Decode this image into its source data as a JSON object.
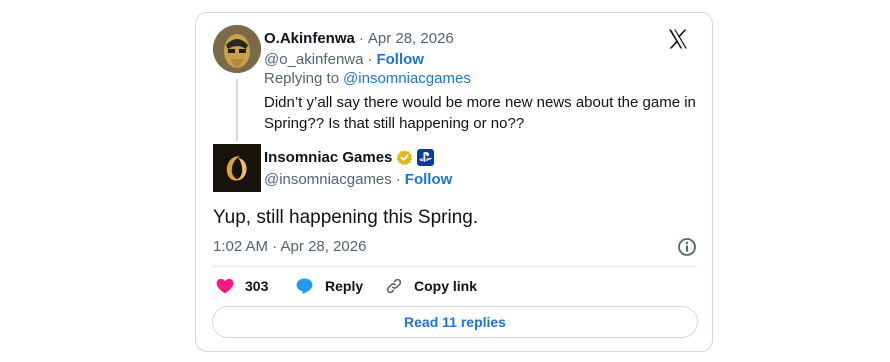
{
  "reply": {
    "display_name": "O.Akinfenwa",
    "date": "Apr 28, 2026",
    "handle": "@o_akinfenwa",
    "follow_label": "Follow",
    "replying_prefix": "Replying to",
    "replying_handle": "@insomniacgames",
    "text_line1": "Didn’t y’all say there would be more new news about the game in",
    "text_line2": "Spring?? Is that still happening or no??"
  },
  "main_tweet": {
    "display_name": "Insomniac Games",
    "handle": "@insomniacgames",
    "follow_label": "Follow",
    "text": "Yup, still happening this Spring.",
    "timestamp": "1:02 AM · Apr 28, 2026"
  },
  "actions": {
    "like_count": "303",
    "reply_label": "Reply",
    "copy_link_label": "Copy link"
  },
  "read_replies_label": "Read 11 replies",
  "colors": {
    "like": "#f91880",
    "reply": "#1d9bf0",
    "link": "#1d74d6",
    "verified": "#e2b719"
  },
  "icons": [
    "x-logo-icon",
    "verified-badge-icon",
    "playstation-icon",
    "info-icon",
    "heart-icon",
    "reply-bubble-icon",
    "link-icon"
  ]
}
